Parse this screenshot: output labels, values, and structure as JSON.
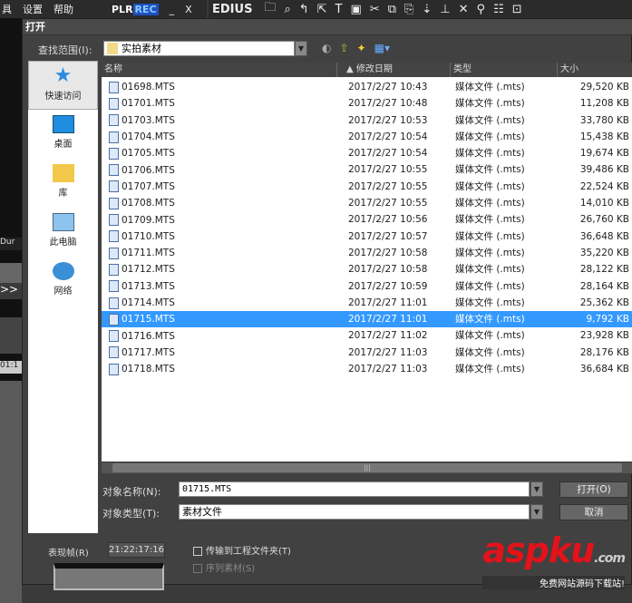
{
  "menubar": {
    "items": [
      "具",
      "设置",
      "帮助"
    ],
    "plr": "PLR",
    "rec": "REC",
    "minimize": "_",
    "close": "X"
  },
  "edius": {
    "logo": "EDIUS"
  },
  "left_strip": {
    "dur": "Dur",
    "ff": ">>",
    "tc": "01:1"
  },
  "dialog": {
    "title": "打开",
    "look_in_label": "查找范围(I):",
    "look_in_value": "实拍素材",
    "sidebar": [
      {
        "label": "快速访问"
      },
      {
        "label": "桌面"
      },
      {
        "label": "库"
      },
      {
        "label": "此电脑"
      },
      {
        "label": "网络"
      }
    ],
    "columns": {
      "name": "名称",
      "date": "▲ 修改日期",
      "type": "类型",
      "size": "大小"
    },
    "files": [
      {
        "name": "01698.MTS",
        "date": "2017/2/27 10:43",
        "type": "媒体文件 (.mts)",
        "size": "29,520 KB"
      },
      {
        "name": "01701.MTS",
        "date": "2017/2/27 10:48",
        "type": "媒体文件 (.mts)",
        "size": "11,208 KB"
      },
      {
        "name": "01703.MTS",
        "date": "2017/2/27 10:53",
        "type": "媒体文件 (.mts)",
        "size": "33,780 KB"
      },
      {
        "name": "01704.MTS",
        "date": "2017/2/27 10:54",
        "type": "媒体文件 (.mts)",
        "size": "15,438 KB"
      },
      {
        "name": "01705.MTS",
        "date": "2017/2/27 10:54",
        "type": "媒体文件 (.mts)",
        "size": "19,674 KB"
      },
      {
        "name": "01706.MTS",
        "date": "2017/2/27 10:55",
        "type": "媒体文件 (.mts)",
        "size": "39,486 KB"
      },
      {
        "name": "01707.MTS",
        "date": "2017/2/27 10:55",
        "type": "媒体文件 (.mts)",
        "size": "22,524 KB"
      },
      {
        "name": "01708.MTS",
        "date": "2017/2/27 10:55",
        "type": "媒体文件 (.mts)",
        "size": "14,010 KB"
      },
      {
        "name": "01709.MTS",
        "date": "2017/2/27 10:56",
        "type": "媒体文件 (.mts)",
        "size": "26,760 KB"
      },
      {
        "name": "01710.MTS",
        "date": "2017/2/27 10:57",
        "type": "媒体文件 (.mts)",
        "size": "36,648 KB"
      },
      {
        "name": "01711.MTS",
        "date": "2017/2/27 10:58",
        "type": "媒体文件 (.mts)",
        "size": "35,220 KB"
      },
      {
        "name": "01712.MTS",
        "date": "2017/2/27 10:58",
        "type": "媒体文件 (.mts)",
        "size": "28,122 KB"
      },
      {
        "name": "01713.MTS",
        "date": "2017/2/27 10:59",
        "type": "媒体文件 (.mts)",
        "size": "28,164 KB"
      },
      {
        "name": "01714.MTS",
        "date": "2017/2/27 11:01",
        "type": "媒体文件 (.mts)",
        "size": "25,362 KB"
      },
      {
        "name": "01715.MTS",
        "date": "2017/2/27 11:01",
        "type": "媒体文件 (.mts)",
        "size": "9,792 KB",
        "selected": true
      },
      {
        "name": "01716.MTS",
        "date": "2017/2/27 11:02",
        "type": "媒体文件 (.mts)",
        "size": "23,928 KB"
      },
      {
        "name": "01717.MTS",
        "date": "2017/2/27 11:03",
        "type": "媒体文件 (.mts)",
        "size": "28,176 KB"
      },
      {
        "name": "01718.MTS",
        "date": "2017/2/27 11:03",
        "type": "媒体文件 (.mts)",
        "size": "36,684 KB"
      }
    ],
    "filename_label": "对象名称(N):",
    "filename_value": "01715.MTS",
    "filetype_label": "对象类型(T):",
    "filetype_value": "素材文件",
    "open_button": "打开(O)",
    "cancel_button": "取消",
    "frame_label": "表现帧(R)",
    "frame_value": "21:22:17:16",
    "transfer_checkbox": "传输到工程文件夹(T)",
    "sequence_checkbox": "序列素材(S)"
  },
  "watermark": {
    "text": "aspku",
    "suffix": ".com",
    "sub": "免费网站源码下载站!"
  }
}
